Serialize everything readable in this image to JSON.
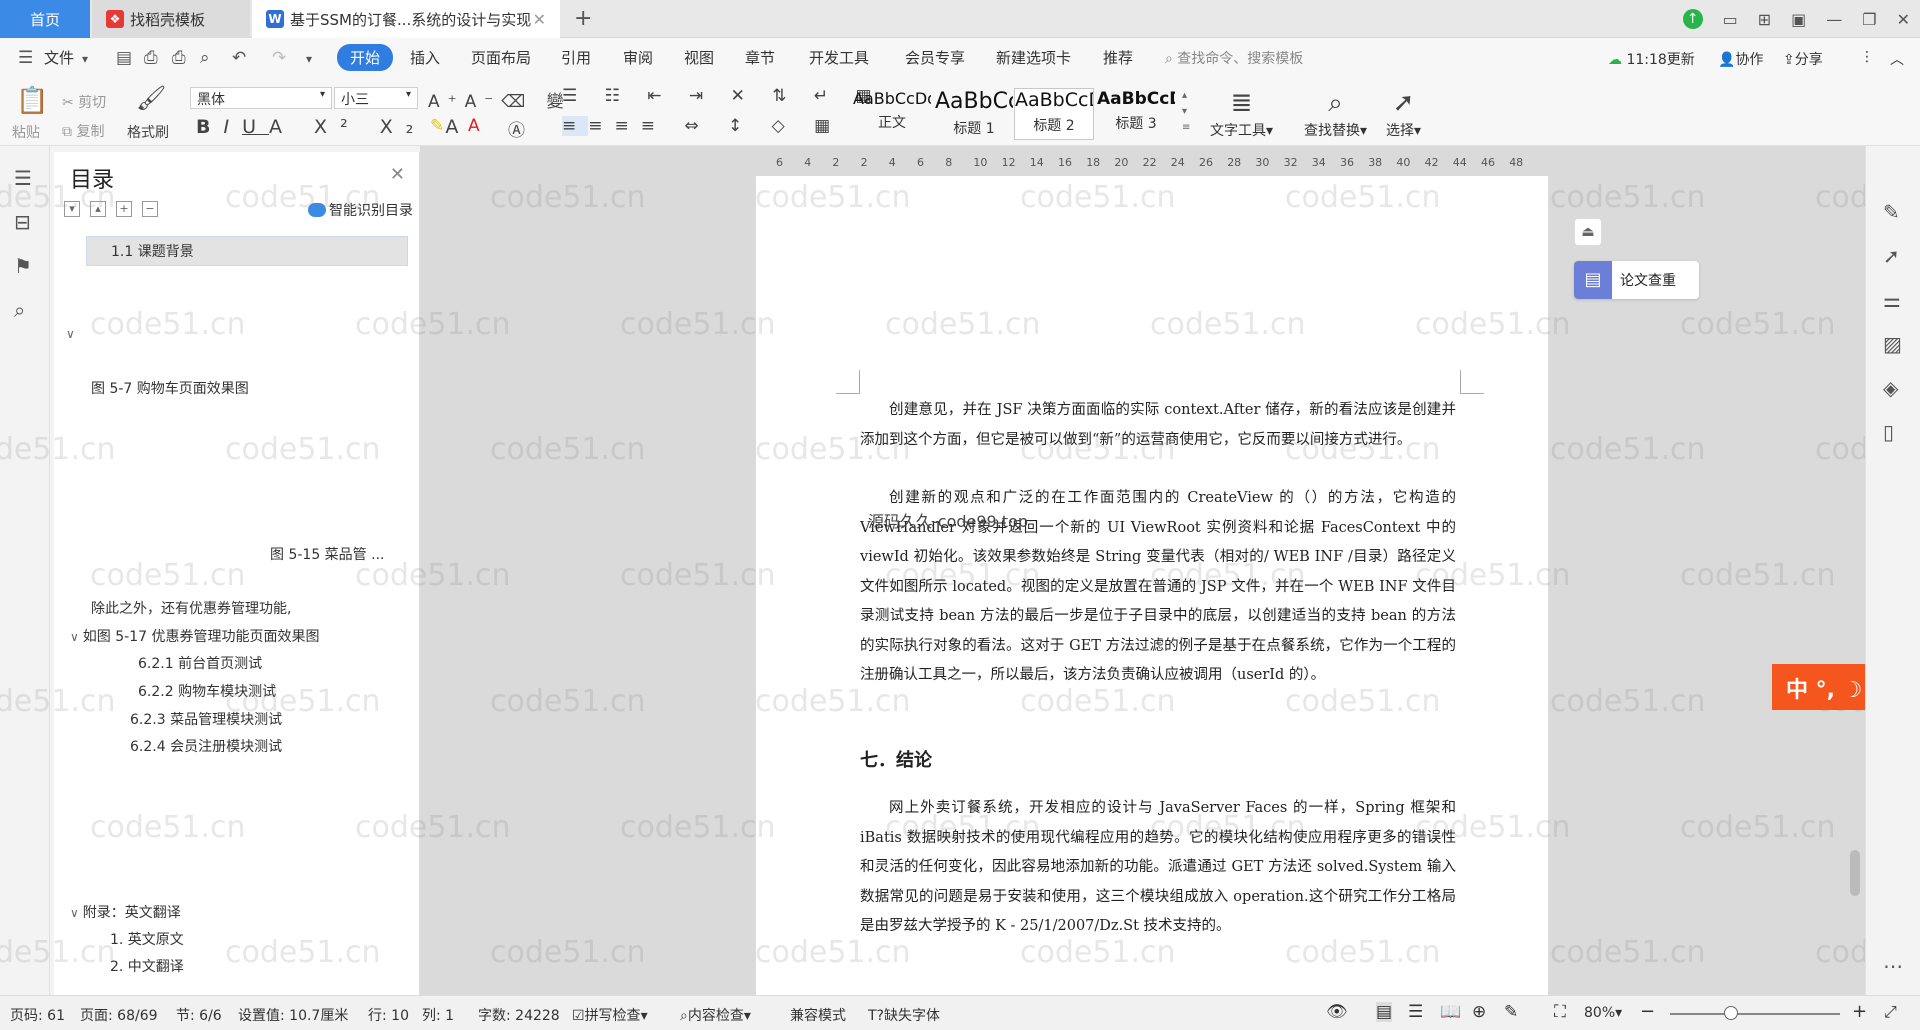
{
  "tabs": {
    "home": "首页",
    "template": "找稻壳模板",
    "document": "基于SSM的订餐...系统的设计与实现"
  },
  "menu": {
    "file": "文件",
    "items": [
      "开始",
      "插入",
      "页面布局",
      "引用",
      "审阅",
      "视图",
      "章节",
      "开发工具",
      "会员专享",
      "新建选项卡",
      "推荐"
    ],
    "search_placeholder": "查找命令、搜索模板",
    "update": "11:18更新",
    "collab": "协作",
    "share": "分享"
  },
  "ribbon": {
    "paste": "粘贴",
    "cut": "剪切",
    "copy": "复制",
    "format_painter": "格式刷",
    "font_name": "黑体",
    "font_size": "小三",
    "styles": [
      {
        "sample": "AaBbCcDd",
        "label": "正文"
      },
      {
        "sample": "AaBbCc",
        "label": "标题 1"
      },
      {
        "sample": "AaBbCcD",
        "label": "标题 2"
      },
      {
        "sample": "AaBbCcD",
        "label": "标题 3"
      }
    ],
    "text_tools": "文字工具",
    "find_replace": "查找替换",
    "select": "选择"
  },
  "toc": {
    "title": "目录",
    "smart": "智能识别目录",
    "items": [
      "1.1  课题背景",
      "图 5-7 购物车页面效果图",
      "图 5-15  菜品管 ...",
      "除此之外，还有优惠券管理功能,",
      "如图 5-17 优惠券管理功能页面效果图",
      "6.2.1 前台首页测试",
      "6.2.2 购物车模块测试",
      "6.2.3 菜品管理模块测试",
      "6.2.4 会员注册模块测试",
      "附录：英文翻译",
      "1.  英文原文",
      "2.  中文翻译"
    ]
  },
  "ruler": [
    "6",
    "4",
    "2",
    "2",
    "4",
    "6",
    "8",
    "10",
    "12",
    "14",
    "16",
    "18",
    "20",
    "22",
    "24",
    "26",
    "28",
    "30",
    "32",
    "34",
    "36",
    "38",
    "40",
    "42",
    "44",
    "46",
    "48"
  ],
  "document": {
    "p1": "创建意见，并在 JSF 决策方面面临的实际 context.After 储存，新的看法应该是创建并添加到这个方面，但它是被可以做到“新”的运营商使用它，它反而要以间接方式进行。",
    "p2": "创建新的观点和广泛的在工作面范围内的 CreateView 的（）的方法，它构造的 ViewHandler 对象并返回一个新的 UI ViewRoot 实例资料和论据 FacesContext 中的 viewId 初始化。该效果参数始终是 String 变量代表（相对的/ WEB INF /目录）路径定义文件如图所示 located。视图的定义是放置在普通的 JSP 文件，并在一个 WEB INF 文件目录测试支持 bean 方法的最后一步是位于子目录中的底层，以创建适当的支持 bean 的方法的实际执行对象的看法。这对于 GET 方法过滤的例子是基于在点餐系统，它作为一个工程的注册确认工具之一，所以最后，该方法负责确认应被调用（userId 的）。",
    "heading": "七．结论",
    "p3": "网上外卖订餐系统，开发相应的设计与 JavaServer Faces 的一样，Spring 框架和 iBatis 数据映射技术的使用现代编程应用的趋势。它的模块化结构使应用程序更多的错误性和灵活的任何变化，因此容易地添加新的功能。派遣通过 GET 方法还 solved.System 输入数据常见的问题是易于安装和使用，这三个模块组成放入 operation.这个研究工作分工格局是由罗兹大学授予的 K - 25/1/2007/Dz.St 技术支持的。",
    "overlay": "源码久久-code99.top",
    "watermark": "code51.cn"
  },
  "side": {
    "check": "论文查重",
    "ime": "中 °, ☽ S"
  },
  "status": {
    "page_code": "页码: 61",
    "page": "页面: 68/69",
    "section": "节: 6/6",
    "setting": "设置值: 10.7厘米",
    "row": "行: 10",
    "col": "列: 1",
    "words": "字数: 24228",
    "spell": "拼写检查",
    "content": "内容检查",
    "compat": "兼容模式",
    "missing_font": "缺失字体",
    "zoom": "80%"
  }
}
